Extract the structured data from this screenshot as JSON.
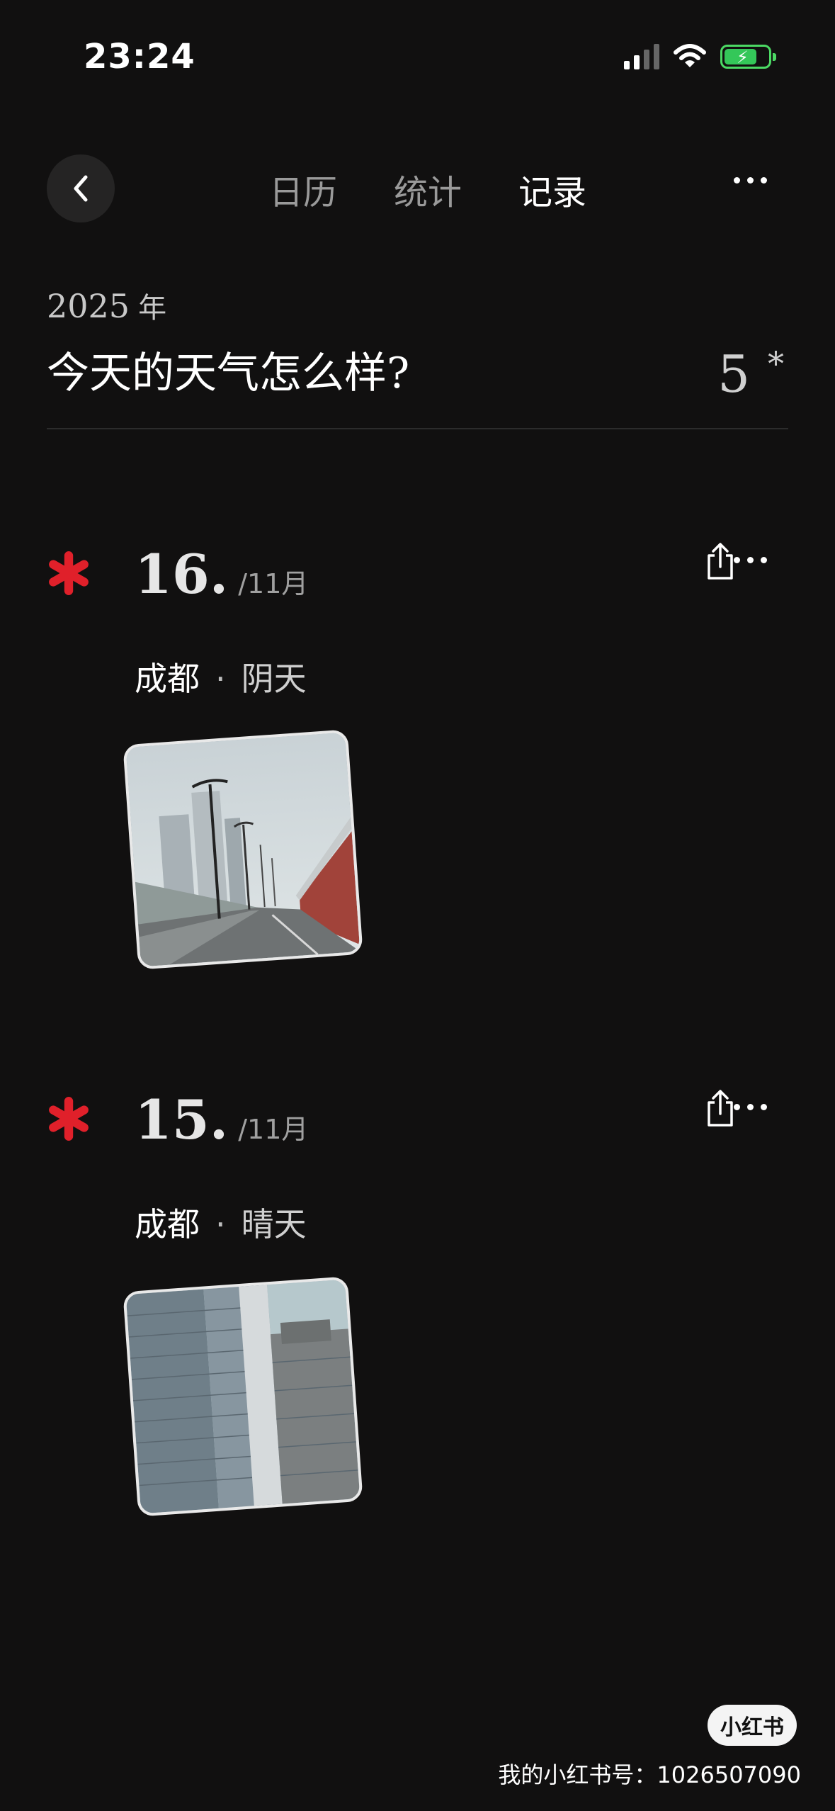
{
  "status_bar": {
    "time": "23:24"
  },
  "nav": {
    "tabs": [
      {
        "label": "日历"
      },
      {
        "label": "统计"
      },
      {
        "label": "记录"
      }
    ],
    "active_tab": "记录"
  },
  "header": {
    "year": "2025",
    "year_unit": "年",
    "question": "今天的天气怎么样?",
    "count": "5",
    "count_mark": "*"
  },
  "entries": [
    {
      "day": "16.",
      "month": "/11月",
      "city": "成都",
      "separator": "·",
      "weather": "阴天"
    },
    {
      "day": "15.",
      "month": "/11月",
      "city": "成都",
      "separator": "·",
      "weather": "晴天"
    }
  ],
  "watermark": {
    "badge": "小红书",
    "id_text": "我的小红书号：1026507090"
  },
  "colors": {
    "background": "#111010",
    "accent_asterisk": "#e0202a",
    "battery": "#34c759"
  },
  "icons": [
    "back-chevron-icon",
    "more-icon",
    "share-icon",
    "asterisk-icon",
    "signal-icon",
    "wifi-icon",
    "battery-icon"
  ]
}
